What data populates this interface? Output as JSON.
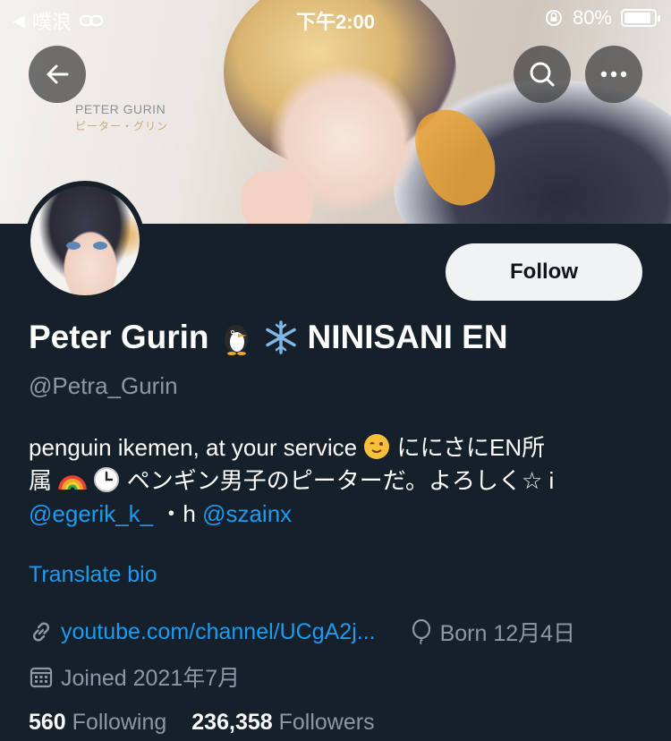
{
  "status_bar": {
    "carrier": "噗浪",
    "time": "下午2:00",
    "battery": "80%"
  },
  "banner": {
    "text_en": "PETER GURIN",
    "text_jp": "ピーター・グリン"
  },
  "profile": {
    "display_name": "Peter Gurin",
    "display_name_suffix": "NINISANI EN",
    "handle": "@Petra_Gurin",
    "bio_line1_a": "penguin ikemen, at your service",
    "bio_line1_b": "ににさにEN所",
    "bio_line2_a": "属",
    "bio_line2_b": "ペンギン男子のピーターだ。よろしく☆ i",
    "bio_mention1": "@egerik_k_",
    "bio_sep": "・h",
    "bio_mention2": "@szainx",
    "translate_label": "Translate bio",
    "link": "youtube.com/channel/UCgA2j...",
    "born": "Born 12月4日",
    "joined": "Joined 2021年7月",
    "following_count": "560",
    "following_label": "Following",
    "followers_count": "236,358",
    "followers_label": "Followers"
  },
  "actions": {
    "follow_label": "Follow"
  },
  "icons": {
    "back": "arrow-left-icon",
    "search": "search-icon",
    "more": "more-icon",
    "link": "link-icon",
    "born": "balloon-icon",
    "calendar": "calendar-icon"
  },
  "colors": {
    "background": "#15202b",
    "accent": "#1d9bf0",
    "secondary_text": "#8b98a5",
    "follow_bg": "#eff3f4"
  }
}
